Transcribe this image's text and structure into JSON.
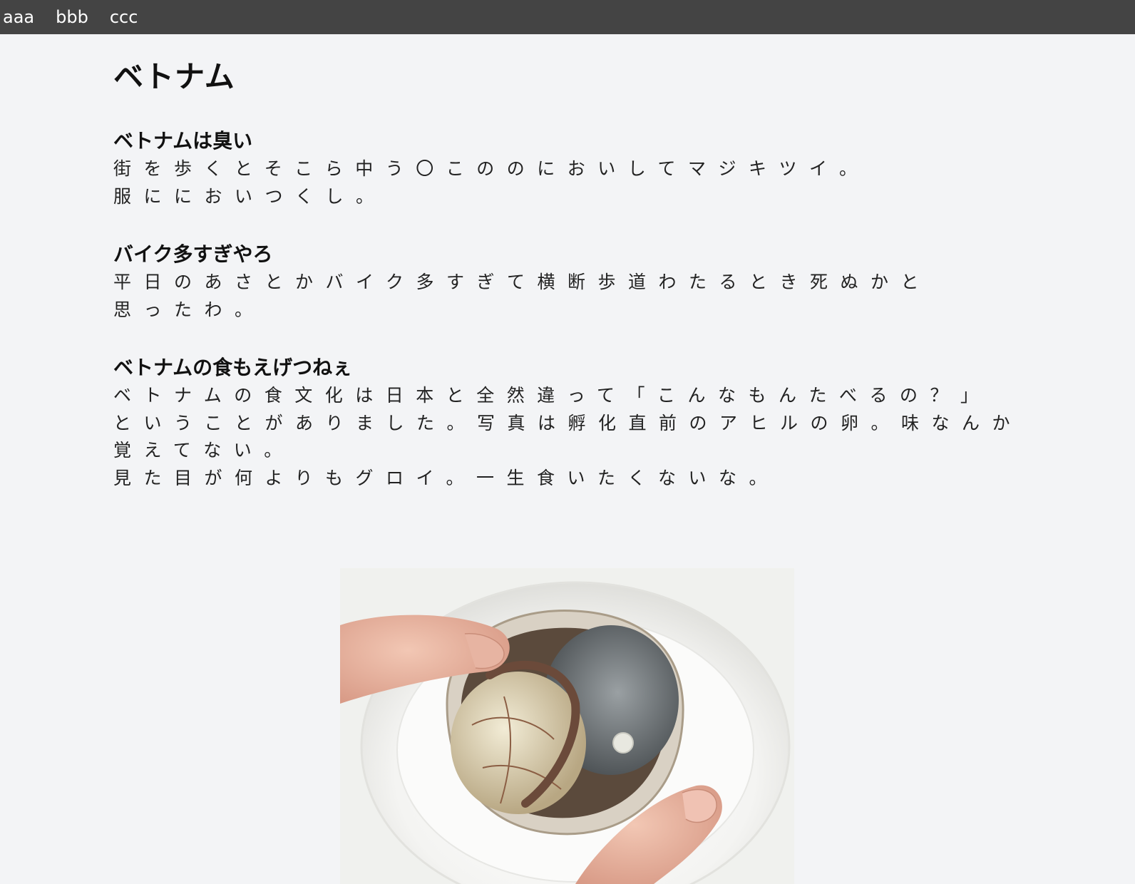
{
  "nav": {
    "items": [
      "aaa",
      "bbb",
      "ccc"
    ]
  },
  "page": {
    "title": "ベトナム"
  },
  "sections": [
    {
      "heading": "ベトナムは臭い",
      "lines": [
        "街を歩くとそこら中う〇こののにおいしてマジキツイ。",
        "服ににおいつくし。"
      ]
    },
    {
      "heading": "バイク多すぎやろ",
      "lines": [
        "平日のあさとかバイク多すぎて横断歩道わたるとき死ぬかと",
        "思ったわ。"
      ]
    },
    {
      "heading": "ベトナムの食もえげつねぇ",
      "lines": [
        "ベトナムの食文化は日本と全然違って「こんなもんたべるの？」",
        "ということがありました。写真は孵化直前のアヒルの卵。味なんか",
        "覚えてない。",
        "見た目が何よりもグロイ。一生食いたくないな。"
      ]
    }
  ],
  "colors": {
    "nav_bg": "#444444",
    "page_bg": "#f3f4f6",
    "text": "#111111"
  },
  "image": {
    "subject": "balut-egg-photo"
  }
}
